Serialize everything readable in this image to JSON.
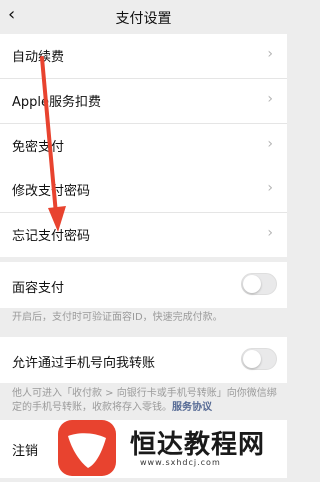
{
  "header": {
    "title": "支付设置",
    "back_icon": "chevron-left-icon"
  },
  "group1": [
    {
      "label": "自动续费"
    },
    {
      "label": "Apple服务扣费"
    },
    {
      "label": "免密支付"
    }
  ],
  "group2": [
    {
      "label": "修改支付密码"
    },
    {
      "label": "忘记支付密码"
    }
  ],
  "face_pay": {
    "label": "面容支付",
    "enabled": false,
    "note": "开启后，支付时可验证面容ID，快速完成付款。"
  },
  "phone_transfer": {
    "label": "允许通过手机号向我转账",
    "enabled": false,
    "note": "他人可进入「收付款 > 向银行卡或手机号转账」向你微信绑定的手机号转账，收款将存入零钱。",
    "note_link": "服务协议"
  },
  "partial_row": {
    "label": "注销"
  },
  "watermark": {
    "text": "恒达教程网",
    "url": "www.sxhdcj.com"
  },
  "colors": {
    "accent_red": "#e8432f",
    "link": "#576b95",
    "background": "#ededed"
  }
}
